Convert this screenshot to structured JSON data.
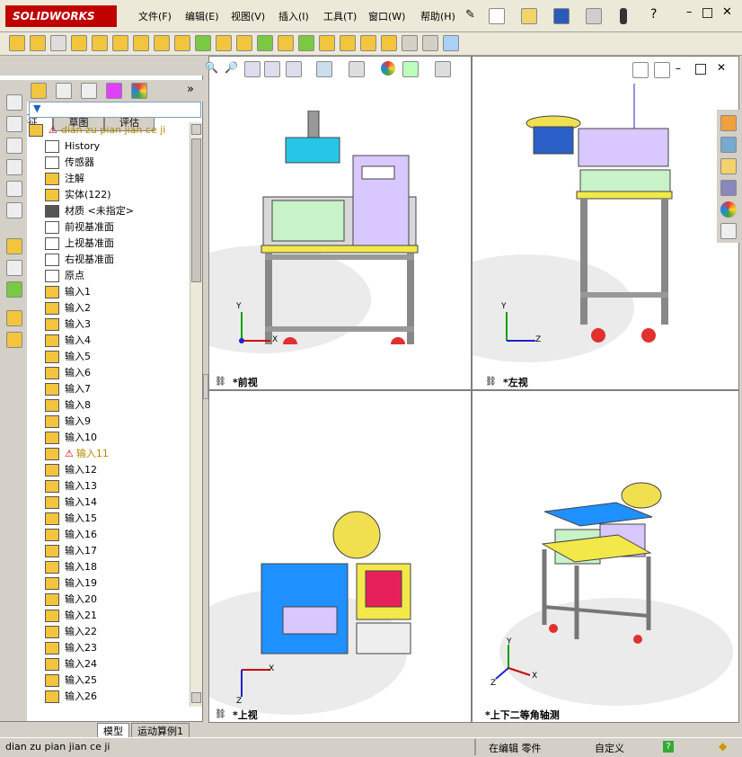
{
  "menu": {
    "brand": "SOLIDWORKS",
    "items": [
      "文件(F)",
      "编辑(E)",
      "视图(V)",
      "插入(I)",
      "工具(T)",
      "窗口(W)",
      "帮助(H)"
    ]
  },
  "panel": {
    "tabs": [
      "特征",
      "草图",
      "评估"
    ],
    "root_label": "dian zu pian jian ce ji",
    "tree": [
      {
        "icon": "history-icon",
        "label": "History"
      },
      {
        "icon": "sensor-icon",
        "label": "传感器"
      },
      {
        "icon": "annotation-icon",
        "label": "注解"
      },
      {
        "icon": "solid-body-icon",
        "label": "实体(122)"
      },
      {
        "icon": "material-icon",
        "label": "材质 <未指定>"
      },
      {
        "icon": "plane-icon",
        "label": "前视基准面"
      },
      {
        "icon": "plane-icon",
        "label": "上视基准面"
      },
      {
        "icon": "plane-icon",
        "label": "右视基准面"
      },
      {
        "icon": "origin-icon",
        "label": "原点"
      },
      {
        "icon": "import-icon",
        "label": "输入1"
      },
      {
        "icon": "import-icon",
        "label": "输入2"
      },
      {
        "icon": "import-icon",
        "label": "输入3"
      },
      {
        "icon": "import-icon",
        "label": "输入4"
      },
      {
        "icon": "import-icon",
        "label": "输入5"
      },
      {
        "icon": "import-icon",
        "label": "输入6"
      },
      {
        "icon": "import-icon",
        "label": "输入7"
      },
      {
        "icon": "import-icon",
        "label": "输入8"
      },
      {
        "icon": "import-icon",
        "label": "输入9"
      },
      {
        "icon": "import-icon",
        "label": "输入10"
      },
      {
        "icon": "warning-icon",
        "label": "输入11"
      },
      {
        "icon": "import-icon",
        "label": "输入12"
      },
      {
        "icon": "import-icon",
        "label": "输入13"
      },
      {
        "icon": "import-icon",
        "label": "输入14"
      },
      {
        "icon": "import-icon",
        "label": "输入15"
      },
      {
        "icon": "import-icon",
        "label": "输入16"
      },
      {
        "icon": "import-icon",
        "label": "输入17"
      },
      {
        "icon": "import-icon",
        "label": "输入18"
      },
      {
        "icon": "import-icon",
        "label": "输入19"
      },
      {
        "icon": "import-icon",
        "label": "输入20"
      },
      {
        "icon": "import-icon",
        "label": "输入21"
      },
      {
        "icon": "import-icon",
        "label": "输入22"
      },
      {
        "icon": "import-icon",
        "label": "输入23"
      },
      {
        "icon": "import-icon",
        "label": "输入24"
      },
      {
        "icon": "import-icon",
        "label": "输入25"
      },
      {
        "icon": "import-icon",
        "label": "输入26"
      }
    ],
    "bottom_tabs": [
      "模型",
      "运动算例1"
    ]
  },
  "views": {
    "front": "*前视",
    "left": "*左视",
    "top": "*上视",
    "iso": "*上下二等角轴测",
    "axis_x": "X",
    "axis_y": "Y",
    "axis_z": "Z"
  },
  "status": {
    "doc_name": "dian zu pian jian ce ji",
    "mode": "在编辑 零件",
    "units": "自定义",
    "help": "?"
  },
  "colors": {
    "accent": "#c00000",
    "frame": "#8a8a8a",
    "blue": "#1e90ff",
    "yellow": "#ffee55",
    "violet": "#d8c8ff"
  }
}
